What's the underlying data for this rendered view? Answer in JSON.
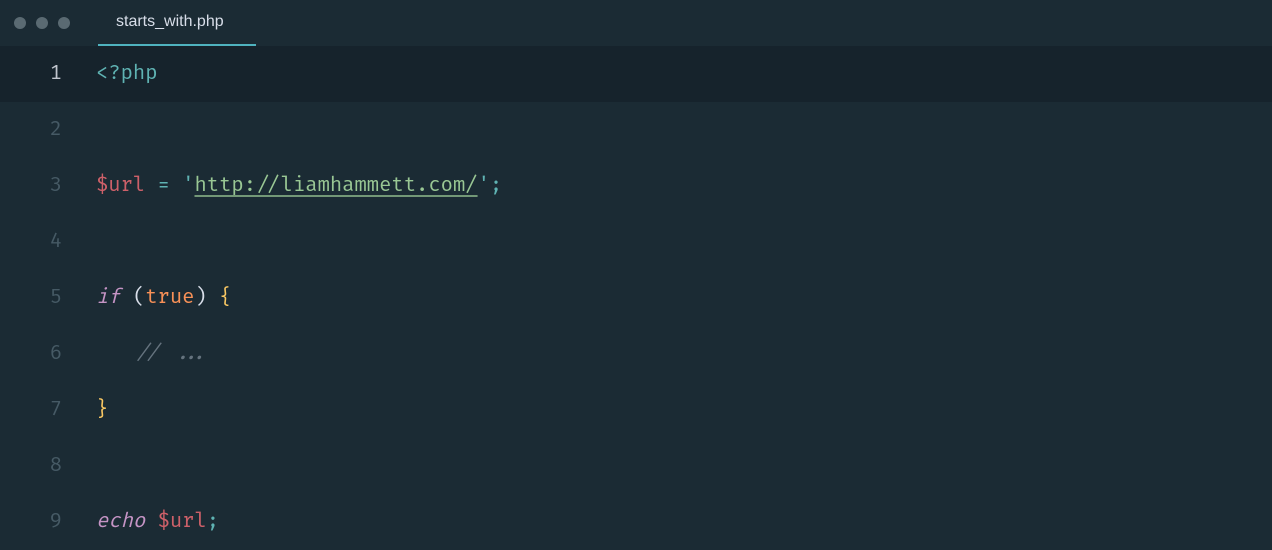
{
  "tab": {
    "filename": "starts_with.php"
  },
  "gutter": {
    "l1": "1",
    "l2": "2",
    "l3": "3",
    "l4": "4",
    "l5": "5",
    "l6": "6",
    "l7": "7",
    "l8": "8",
    "l9": "9"
  },
  "code": {
    "php_open_lt": "<",
    "php_open_q": "?",
    "php_open_word": "php",
    "var_url": "$url",
    "assign": " = ",
    "quote": "'",
    "url_value": "http://liamhammett.com/",
    "semi": ";",
    "kw_if": "if",
    "space": " ",
    "paren_open": "(",
    "const_true": "true",
    "paren_close": ")",
    "brace_open": "{",
    "comment": "// ...",
    "brace_close": "}",
    "kw_echo": "echo"
  }
}
